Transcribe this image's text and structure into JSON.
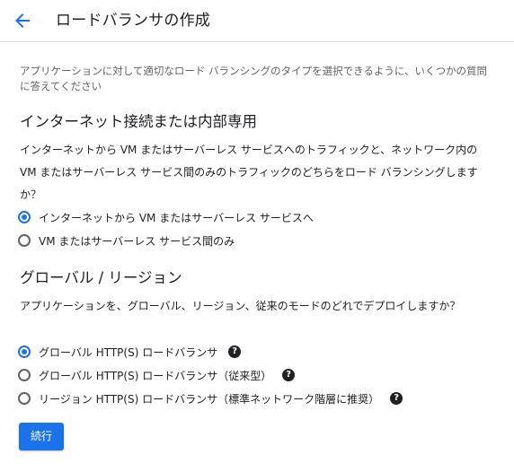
{
  "header": {
    "title": "ロードバランサの作成",
    "back_icon": "arrow-back-icon",
    "accent": "#1a73e8"
  },
  "intro": "アプリケーションに対して適切なロード バランシングのタイプを選択できるように、いくつかの質問に答えてください",
  "section1": {
    "heading": "インターネット接続または内部専用",
    "question": "インターネットから VM またはサーバーレス サービスへのトラフィックと、ネットワーク内の VM またはサーバーレス サービス間のみのトラフィックのどちらをロード バランシングしますか？",
    "options": [
      {
        "label": "インターネットから VM またはサーバーレス サービスへ",
        "selected": true
      },
      {
        "label": "VM またはサーバーレス サービス間のみ",
        "selected": false
      }
    ]
  },
  "section2": {
    "heading": "グローバル / リージョン",
    "question": "アプリケーションを、グローバル、リージョン、従来のモードのどれでデプロイしますか？",
    "options": [
      {
        "label": "グローバル HTTP(S) ロードバランサ",
        "selected": true,
        "help_icon": "help-icon"
      },
      {
        "label": "グローバル HTTP(S) ロードバランサ（従来型）",
        "selected": false,
        "help_icon": "help-icon"
      },
      {
        "label": "リージョン HTTP(S) ロードバランサ（標準ネットワーク階層に推奨）",
        "selected": false,
        "help_icon": "help-icon"
      }
    ]
  },
  "continue_label": "続行"
}
